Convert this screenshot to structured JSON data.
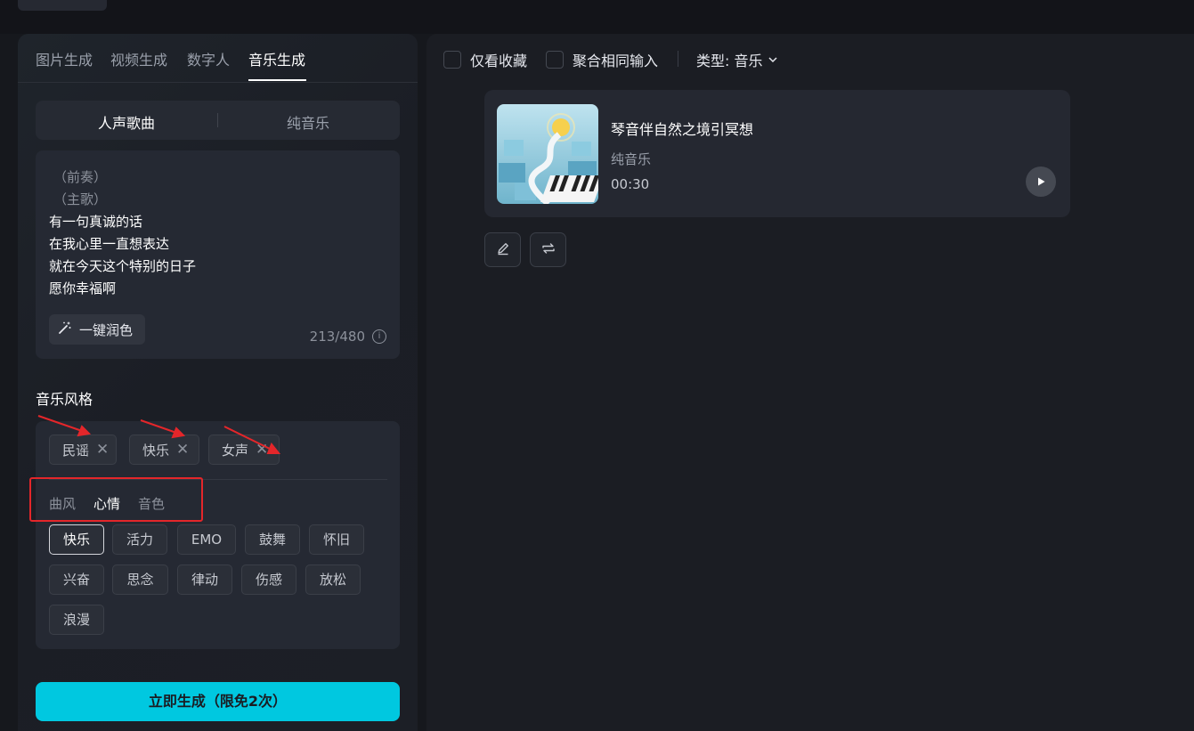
{
  "tabs": [
    {
      "label": "图片生成",
      "active": false
    },
    {
      "label": "视频生成",
      "active": false
    },
    {
      "label": "数字人",
      "active": false
    },
    {
      "label": "音乐生成",
      "active": true
    }
  ],
  "mode": {
    "vocal": "人声歌曲",
    "instrumental": "纯音乐",
    "selected": "人声歌曲"
  },
  "lyrics": {
    "lines": [
      "（前奏）",
      "（主歌）",
      "有一句真诚的话",
      "在我心里一直想表达",
      "就在今天这个特别的日子",
      "愿你幸福啊"
    ],
    "polish_label": "一键润色",
    "counter": "213/480",
    "info_icon": "info-icon"
  },
  "style": {
    "title": "音乐风格",
    "chips": [
      "民谣",
      "快乐",
      "女声"
    ],
    "remove_icon": "close-icon",
    "subtabs": [
      {
        "label": "曲风",
        "active": false
      },
      {
        "label": "心情",
        "active": true
      },
      {
        "label": "音色",
        "active": false
      }
    ],
    "options": [
      {
        "label": "快乐",
        "selected": true
      },
      {
        "label": "活力",
        "selected": false
      },
      {
        "label": "EMO",
        "selected": false
      },
      {
        "label": "鼓舞",
        "selected": false
      },
      {
        "label": "怀旧",
        "selected": false
      },
      {
        "label": "兴奋",
        "selected": false
      },
      {
        "label": "思念",
        "selected": false
      },
      {
        "label": "律动",
        "selected": false
      },
      {
        "label": "伤感",
        "selected": false
      },
      {
        "label": "放松",
        "selected": false
      },
      {
        "label": "浪漫",
        "selected": false
      }
    ]
  },
  "generate_label": "立即生成（限免2次）",
  "filters": {
    "favorites_only": "仅看收藏",
    "merge_same_input": "聚合相同输入",
    "type_label": "类型: 音乐"
  },
  "result": {
    "title": "琴音伴自然之境引冥想",
    "type": "纯音乐",
    "duration": "00:30"
  },
  "colors": {
    "accent": "#00c8e0",
    "annotation": "#e4262a"
  }
}
